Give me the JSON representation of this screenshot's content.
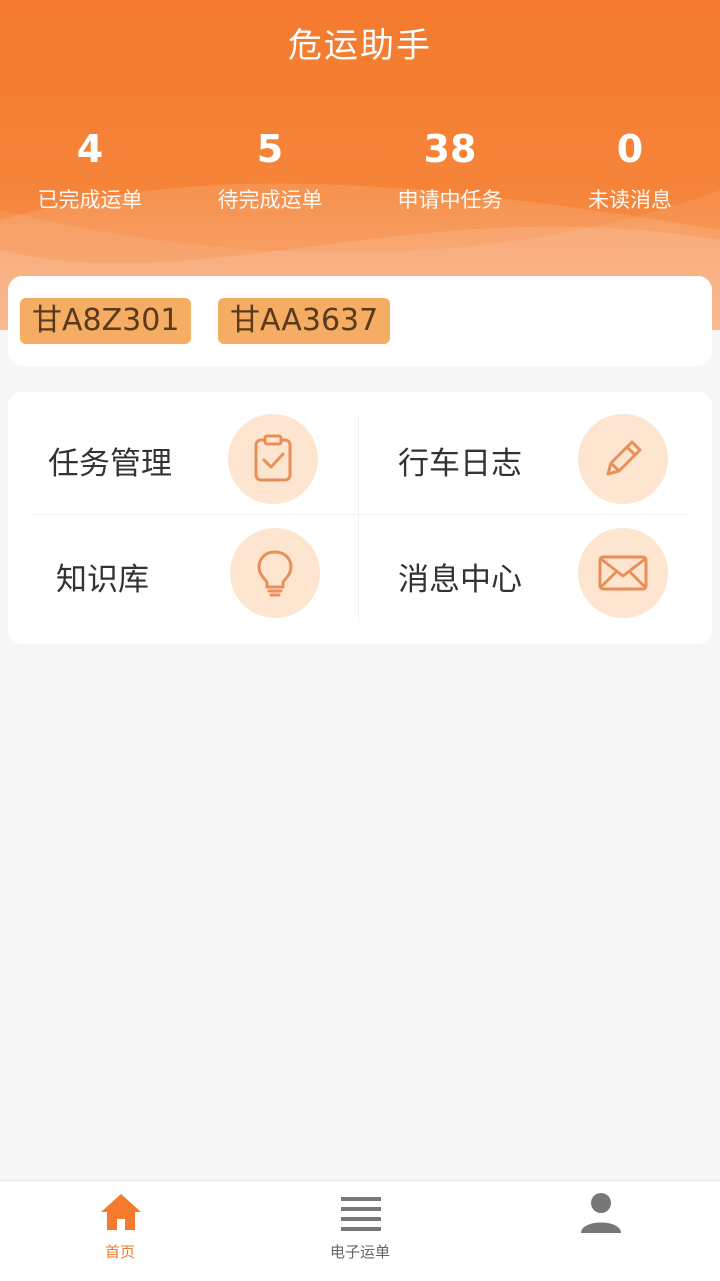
{
  "header": {
    "title": "危运助手",
    "stats": [
      {
        "value": "4",
        "label": "已完成运单"
      },
      {
        "value": "5",
        "label": "待完成运单"
      },
      {
        "value": "38",
        "label": "申请中任务"
      },
      {
        "value": "0",
        "label": "未读消息"
      }
    ]
  },
  "plates": [
    "甘A8Z301",
    "甘AA3637"
  ],
  "menu": [
    {
      "label": "任务管理",
      "icon": "clipboard-check-icon"
    },
    {
      "label": "行车日志",
      "icon": "pencil-icon"
    },
    {
      "label": "知识库",
      "icon": "lightbulb-icon"
    },
    {
      "label": "消息中心",
      "icon": "envelope-icon"
    }
  ],
  "tabs": [
    {
      "label": "首页",
      "icon": "home-icon",
      "active": true
    },
    {
      "label": "电子运单",
      "icon": "list-icon",
      "active": false
    },
    {
      "label": "",
      "icon": "user-icon",
      "active": false
    }
  ],
  "colors": {
    "primary": "#f47a2e",
    "plate": "#f5ac63",
    "icon_bg": "#fde5cf",
    "icon_stroke": "#e8905a"
  }
}
